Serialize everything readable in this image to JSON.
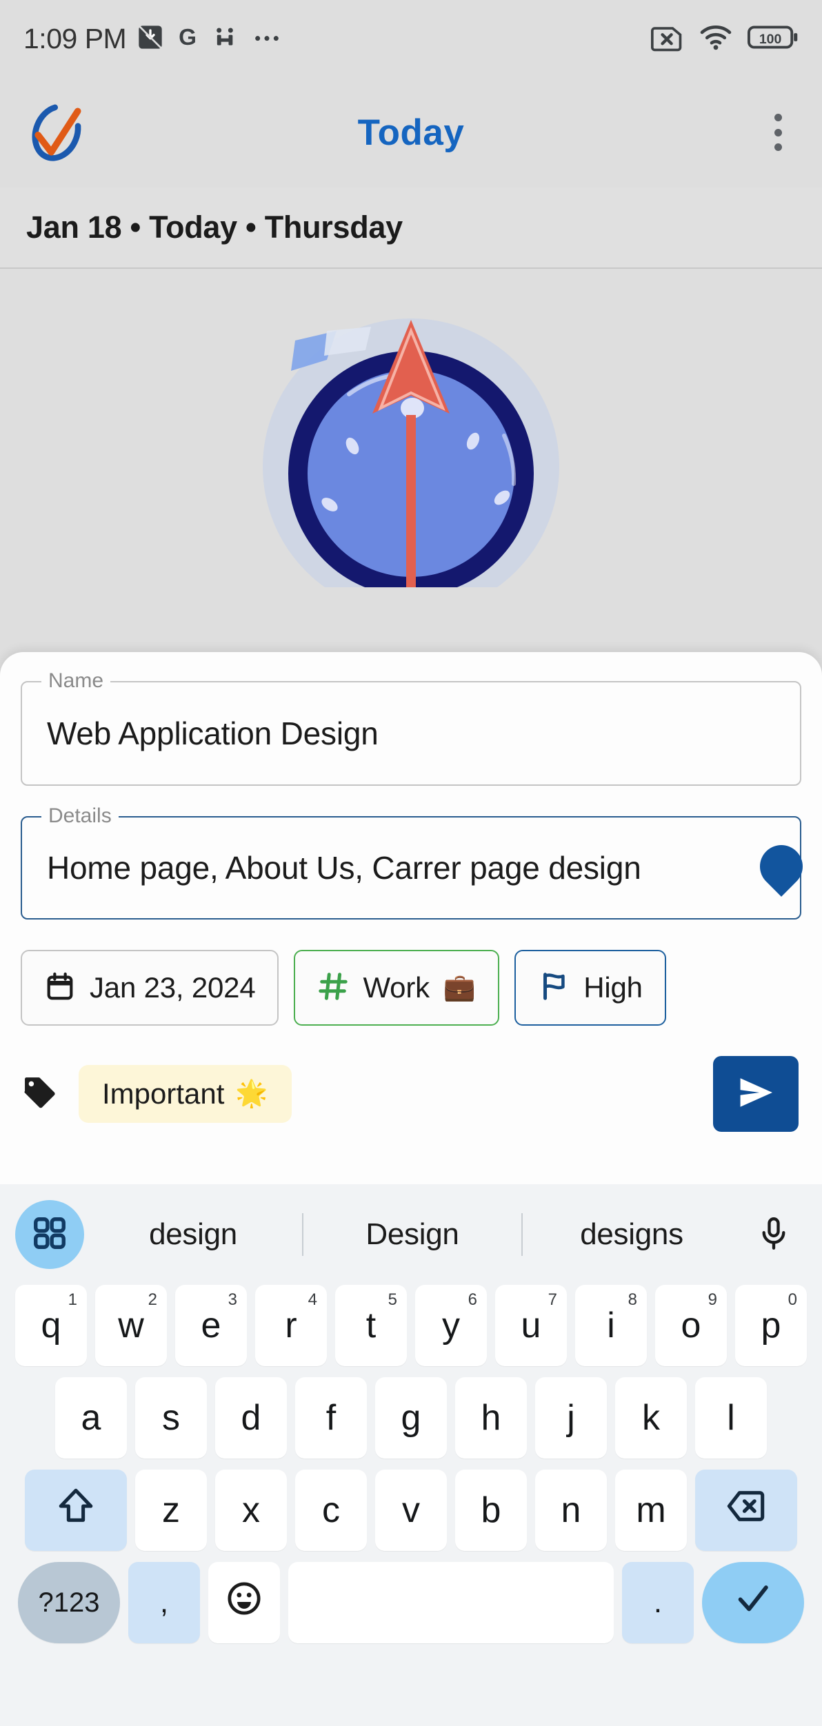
{
  "status_bar": {
    "time": "1:09 PM",
    "left_icons": [
      "drive-download-icon",
      "google-g-icon",
      "health-icon",
      "overflow-dots-icon"
    ],
    "right_icons": [
      "sim-card-error-icon",
      "wifi-icon",
      "battery-icon"
    ],
    "battery_level": "100"
  },
  "app_bar": {
    "logo_name": "app-logo-check-circle",
    "title": "Today",
    "menu_label": "overflow-menu"
  },
  "date_header": {
    "text": "Jan 18 • Today • Thursday"
  },
  "illustration": {
    "name": "clock-compass-illustration"
  },
  "form": {
    "name_field": {
      "label": "Name",
      "value": "Web Application Design",
      "placeholder": "Name"
    },
    "details_field": {
      "label": "Details",
      "value": "Home page, About Us, Carrer page design",
      "placeholder": "Details"
    },
    "chips": [
      {
        "icon": "calendar-icon",
        "label": "Jan 23, 2024",
        "emoji": "",
        "style": "default"
      },
      {
        "icon": "hash-icon",
        "label": "Work",
        "emoji": "💼",
        "style": "green"
      },
      {
        "icon": "flag-icon",
        "label": "High",
        "emoji": "",
        "style": "blue"
      }
    ],
    "tag": {
      "icon": "tag-icon",
      "label": "Important",
      "emoji": "🌟"
    },
    "send_button": {
      "label": "send-task",
      "icon": "send-icon"
    }
  },
  "keyboard": {
    "suggestions": [
      "design",
      "Design",
      "designs"
    ],
    "grid_icon": "app-grid-icon",
    "mic_icon": "microphone-icon",
    "row1": [
      {
        "key": "q",
        "sup": "1"
      },
      {
        "key": "w",
        "sup": "2"
      },
      {
        "key": "e",
        "sup": "3"
      },
      {
        "key": "r",
        "sup": "4"
      },
      {
        "key": "t",
        "sup": "5"
      },
      {
        "key": "y",
        "sup": "6"
      },
      {
        "key": "u",
        "sup": "7"
      },
      {
        "key": "i",
        "sup": "8"
      },
      {
        "key": "o",
        "sup": "9"
      },
      {
        "key": "p",
        "sup": "0"
      }
    ],
    "row2": [
      "a",
      "s",
      "d",
      "f",
      "g",
      "h",
      "j",
      "k",
      "l"
    ],
    "row3": [
      "z",
      "x",
      "c",
      "v",
      "b",
      "n",
      "m"
    ],
    "shift_label": "shift-icon",
    "backspace_label": "backspace-icon",
    "symbols_label": "?123",
    "comma_label": ",",
    "emoji_label": "emoji-icon",
    "space_label": "",
    "period_label": ".",
    "enter_label": "checkmark-icon"
  },
  "colors": {
    "accent_blue": "#1565c0",
    "send_blue": "#0f4d94",
    "chip_green": "#4caf50",
    "chip_blue": "#1c5f9e",
    "tag_yellow": "#fdf6d8",
    "key_blue": "#cfe3f7"
  }
}
